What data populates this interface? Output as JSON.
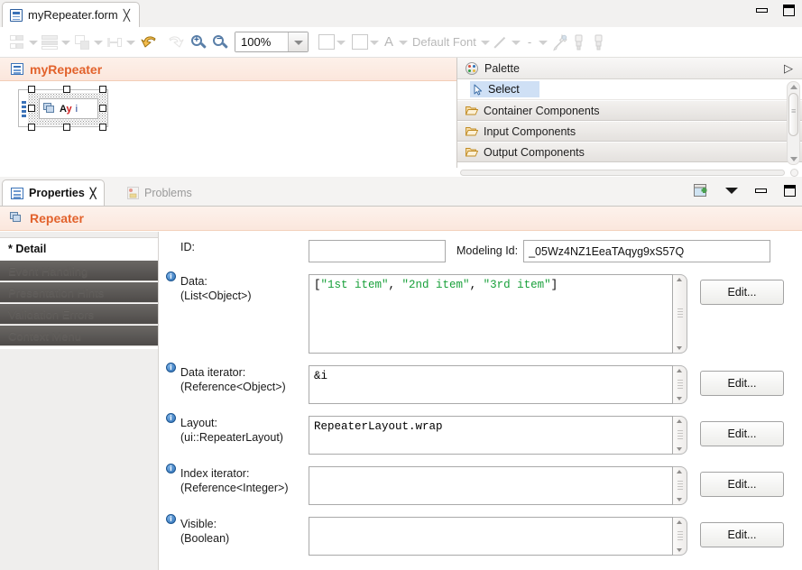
{
  "window": {
    "tab_title": "myRepeater.form",
    "tab_close": "✕",
    "minimize": "minimize-button",
    "maximize": "maximize-button"
  },
  "toolbar": {
    "zoom_value": "100%",
    "font_label": "Default Font",
    "text_A": "A",
    "dash": "-"
  },
  "canvas": {
    "form_title": "myRepeater",
    "widget": {
      "label_a": "A",
      "label_y": "y",
      "label_i": "i"
    }
  },
  "palette": {
    "title": "Palette",
    "expand_glyph": "▷",
    "select_label": "Select",
    "categories": [
      {
        "label": "Container Components"
      },
      {
        "label": "Input Components"
      },
      {
        "label": "Output Components"
      }
    ]
  },
  "properties": {
    "tabs": [
      {
        "label": "Properties",
        "active": true,
        "close": "✕"
      },
      {
        "label": "Problems",
        "active": false
      }
    ],
    "header_title": "Repeater",
    "nav_items": [
      {
        "label": "* Detail",
        "state": "selected"
      },
      {
        "label": "Event Handling",
        "state": "dim"
      },
      {
        "label": "Presentation Hints",
        "state": "dim"
      },
      {
        "label": "Validation Errors",
        "state": "dim"
      },
      {
        "label": "Context Menu",
        "state": "dim"
      }
    ],
    "id_label": "ID:",
    "id_value": "",
    "modeling_id_label": "Modeling Id:",
    "modeling_id_value": "_05Wz4NZ1EeaTAqyg9xS57Q",
    "fields": [
      {
        "name": "Data:",
        "type": "(List<Object>)",
        "value_prefix": "[",
        "value_items": [
          "\"1st item\"",
          "\"2nd item\"",
          "\"3rd item\""
        ],
        "value_suffix": "]",
        "value_plain": "[\"1st item\", \"2nd item\", \"3rd item\"]",
        "button": "Edit..."
      },
      {
        "name": "Data iterator:",
        "type": "(Reference<Object>)",
        "value_plain": "&i",
        "button": "Edit..."
      },
      {
        "name": "Layout:",
        "type": "(ui::RepeaterLayout)",
        "value_plain": "RepeaterLayout.wrap",
        "button": "Edit..."
      },
      {
        "name": "Index iterator:",
        "type": "(Reference<Integer>)",
        "value_plain": "",
        "button": "Edit..."
      },
      {
        "name": "Visible:",
        "type": "(Boolean)",
        "value_plain": "",
        "button": "Edit..."
      }
    ],
    "info_marker": "i"
  },
  "colors": {
    "accent_orange": "#e2622c",
    "string_green": "#18a03a",
    "selection_blue": "#cfe0f5"
  }
}
